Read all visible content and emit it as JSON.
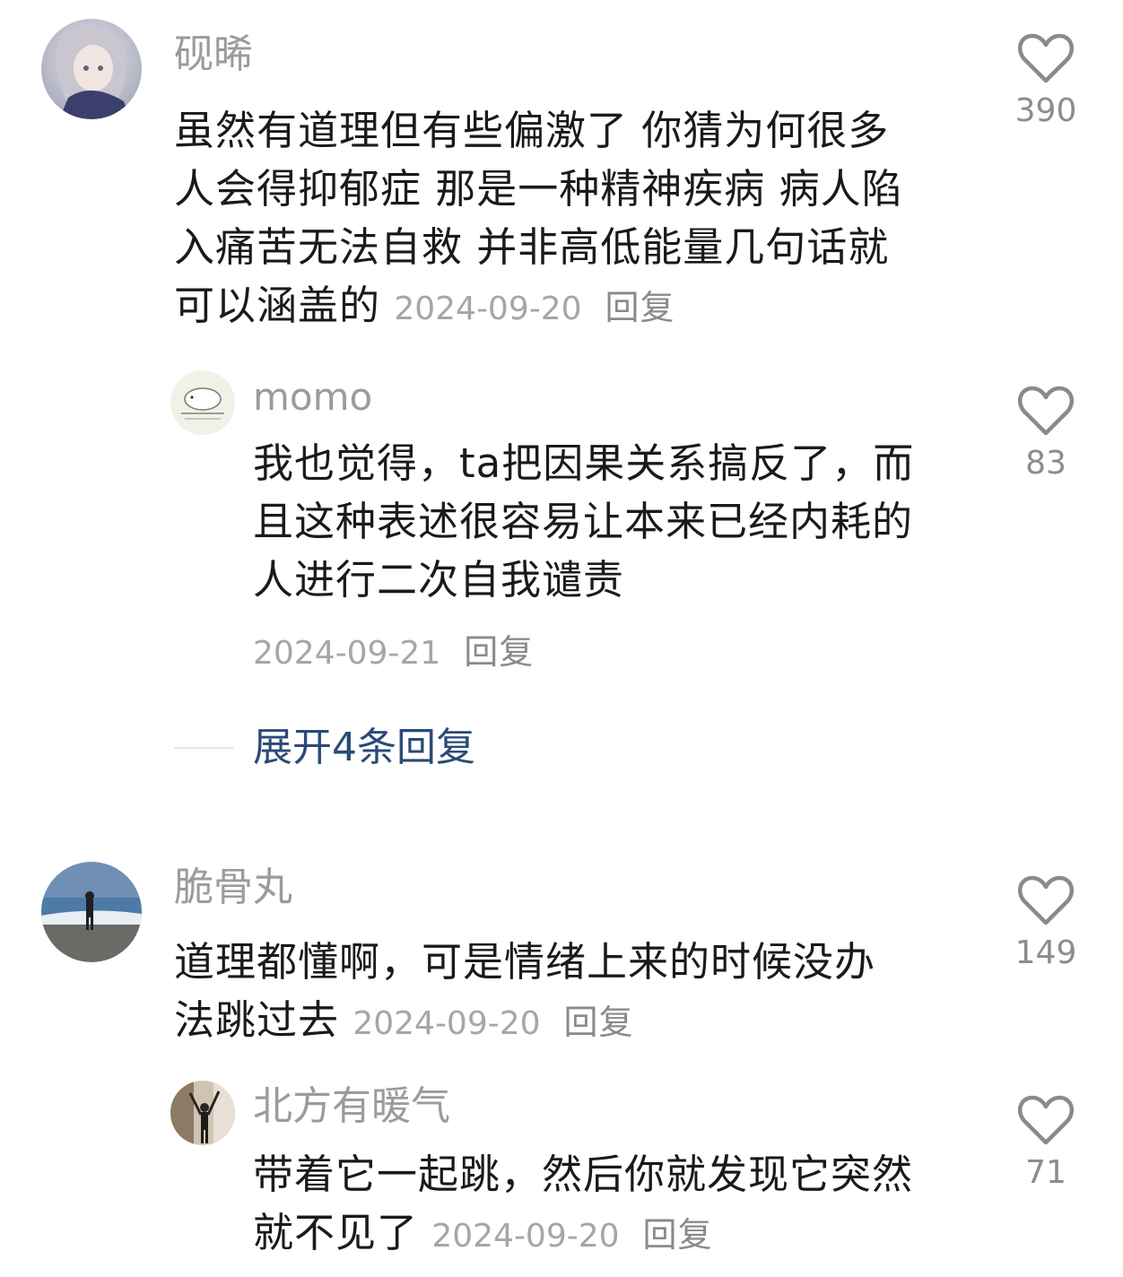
{
  "comments": [
    {
      "username": "砚晞",
      "lines": [
        "虽然有道理但有些偏激了 你猜为何很多",
        "人会得抑郁症 那是一种精神疾病 病人陷",
        "入痛苦无法自救 并非高低能量几句话就"
      ],
      "last_line": "可以涵盖的",
      "date": "2024-09-20",
      "reply_label": "回复",
      "likes": "390",
      "avatar_icon": "avatar-anime-girl-icon"
    },
    {
      "username": "momo",
      "lines": [
        "我也觉得，ta把因果关系搞反了，而",
        "且这种表述很容易让本来已经内耗的",
        "人进行二次自我谴责"
      ],
      "date": "2024-09-21",
      "reply_label": "回复",
      "likes": "83",
      "avatar_icon": "avatar-seal-cartoon-icon"
    },
    {
      "expand_label": "展开4条回复"
    },
    {
      "username": "脆骨丸",
      "lines": [
        "道理都懂啊，可是情绪上来的时候没办"
      ],
      "last_line": "法跳过去",
      "date": "2024-09-20",
      "reply_label": "回复",
      "likes": "149",
      "avatar_icon": "avatar-beach-person-icon"
    },
    {
      "username": "北方有暖气",
      "lines": [
        "带着它一起跳，然后你就发现它突然"
      ],
      "last_line": "就不见了",
      "date": "2024-09-20",
      "reply_label": "回复",
      "likes": "71",
      "avatar_icon": "avatar-dancer-icon"
    }
  ],
  "colors": {
    "username": "#9b9b9b",
    "body_text": "#1a1a1a",
    "meta_text": "#a6a6a6",
    "expand_link": "#2a4a78",
    "heart_outline": "#8a8a8a"
  }
}
